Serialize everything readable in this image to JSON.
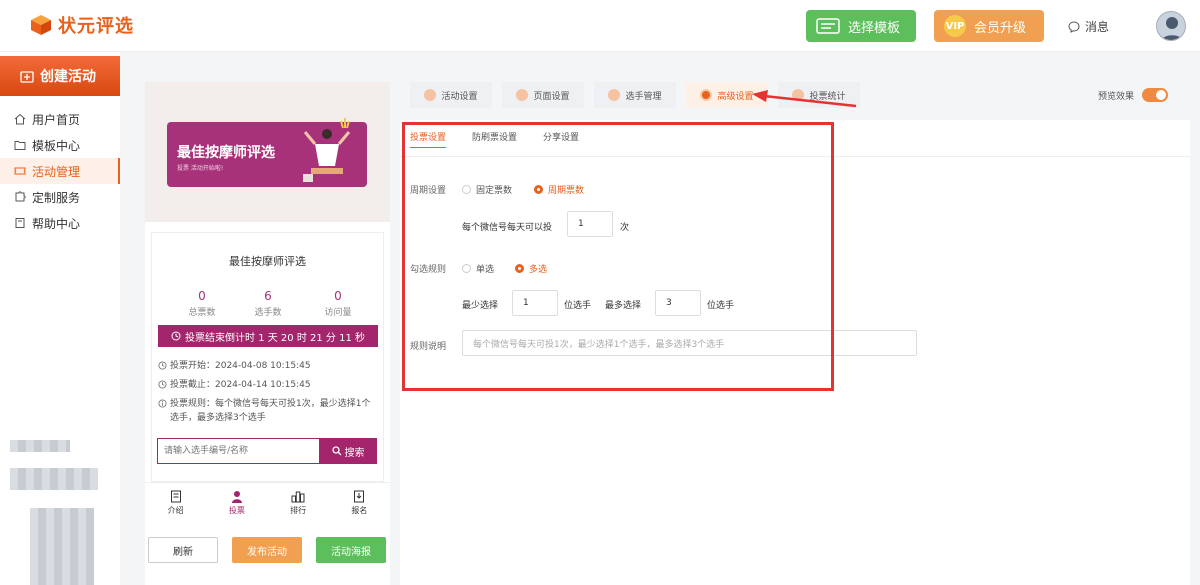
{
  "header": {
    "logo_text": "状元评选",
    "template_button": "选择模板",
    "vip_badge": "VIP",
    "vip_button": "会员升级",
    "messages": "消息"
  },
  "sidebar": {
    "create_button": "创建活动",
    "items": [
      {
        "label": "用户首页",
        "icon": "home-icon"
      },
      {
        "label": "模板中心",
        "icon": "folder-icon"
      },
      {
        "label": "活动管理",
        "icon": "ticket-icon"
      },
      {
        "label": "定制服务",
        "icon": "puzzle-icon"
      },
      {
        "label": "帮助中心",
        "icon": "book-icon"
      }
    ],
    "active_index": 2
  },
  "preview": {
    "banner_title": "最佳按摩师评选",
    "banner_sub": "投票 活动开始啦!",
    "activity_title": "最佳按摩师评选",
    "stats": [
      {
        "value": "0",
        "label": "总票数"
      },
      {
        "value": "6",
        "label": "选手数"
      },
      {
        "value": "0",
        "label": "访问量"
      }
    ],
    "countdown": "投票结束倒计时 1 天 20 时 21 分 11 秒",
    "details": [
      "投票开始：2024-04-08 10:15:45",
      "投票截止：2024-04-14 10:15:45",
      "投票规则：每个微信号每天可投1次，最少选择1个选手，最多选择3个选手"
    ],
    "search_placeholder": "请输入选手编号/名称",
    "search_button": "搜索",
    "tabbar": [
      {
        "label": "介绍",
        "icon": "document-icon"
      },
      {
        "label": "投票",
        "icon": "person-icon"
      },
      {
        "label": "排行",
        "icon": "ranking-icon"
      },
      {
        "label": "报名",
        "icon": "download-icon"
      }
    ],
    "tabbar_active": 1,
    "buttons": {
      "refresh": "刷新",
      "publish": "发布活动",
      "poster": "活动海报"
    }
  },
  "top_tabs": [
    {
      "label": "活动设置"
    },
    {
      "label": "页面设置"
    },
    {
      "label": "选手管理"
    },
    {
      "label": "高级设置"
    },
    {
      "label": "投票统计"
    }
  ],
  "top_tabs_active": 3,
  "preview_toggle": {
    "label": "预览效果",
    "on": true
  },
  "settings": {
    "sub_tabs": [
      "投票设置",
      "防刷票设置",
      "分享设置"
    ],
    "sub_tab_active": 0,
    "period_label": "周期设置",
    "period_options": [
      "固定票数",
      "周期票数"
    ],
    "period_selected": 1,
    "daily_text": "每个微信号每天可以投",
    "daily_value": "1",
    "daily_unit": "次",
    "rule_label": "勾选规则",
    "rule_options": [
      "单选",
      "多选"
    ],
    "rule_selected": 1,
    "min_label": "最少选择",
    "min_value": "1",
    "min_unit": "位选手",
    "max_label": "最多选择",
    "max_value": "3",
    "max_unit": "位选手",
    "desc_label": "规则说明",
    "desc_placeholder": "每个微信号每天可投1次，最少选择1个选手，最多选择3个选手"
  },
  "colors": {
    "accent": "#e9611b",
    "brand_purple": "#a3266d",
    "green": "#5cbf5c",
    "orange": "#f0a050",
    "highlight": "#e53333"
  }
}
